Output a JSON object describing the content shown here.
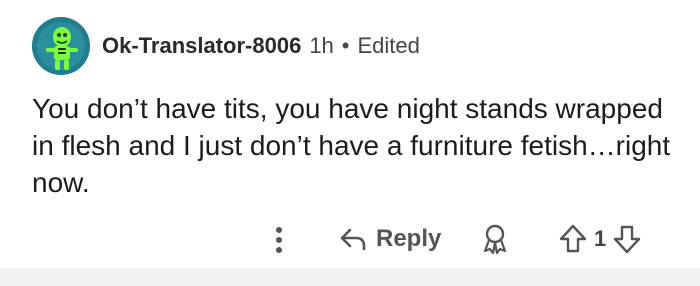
{
  "comment": {
    "username": "Ok-Translator-8006",
    "time": "1h",
    "separator": "•",
    "edited": "Edited",
    "text": "You don’t have tits, you have night stands wrapped in flesh and I just don’t have a furniture fetish…right now.",
    "avatar_icon": "green-cartoon-avatar-icon"
  },
  "actions": {
    "more_icon": "vertical-dots-icon",
    "reply_label": "Reply",
    "reply_icon": "reply-arrow-icon",
    "award_icon": "award-icon",
    "upvote_icon": "upvote-arrow-icon",
    "downvote_icon": "downvote-arrow-icon",
    "vote_count": "1"
  },
  "colors": {
    "avatar_bg": "#1f7f8f",
    "avatar_figure": "#7cff3a",
    "icon_gray": "#555555",
    "footer_bg": "#f2f2f2"
  }
}
